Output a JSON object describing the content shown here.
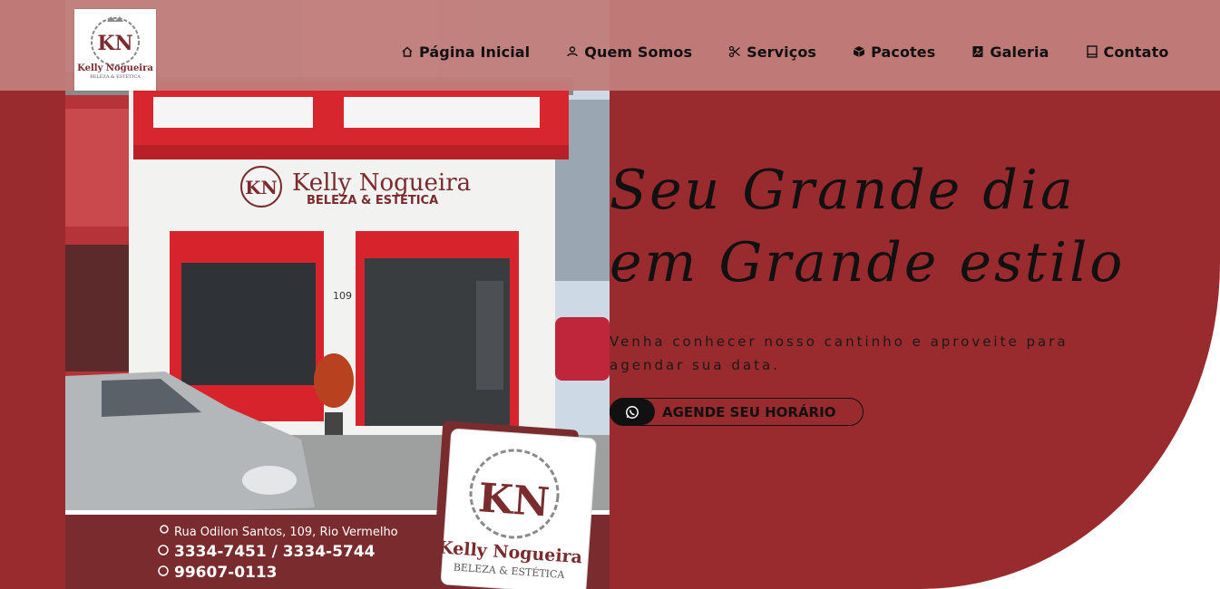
{
  "brand": {
    "name": "Kelly Nogueira",
    "tagline": "BELEZA & ESTÉTICA",
    "monogram": "KN"
  },
  "nav": {
    "items": [
      {
        "label": "Página Inicial",
        "icon": "home-icon"
      },
      {
        "label": "Quem Somos",
        "icon": "people-icon"
      },
      {
        "label": "Serviços",
        "icon": "scissors-icon"
      },
      {
        "label": "Pacotes",
        "icon": "box-icon"
      },
      {
        "label": "Galeria",
        "icon": "gallery-icon"
      },
      {
        "label": "Contato",
        "icon": "book-icon"
      }
    ]
  },
  "hero": {
    "title_line1": "Seu Grande dia",
    "title_line2": "em Grande estilo",
    "subtitle": "Venha conhecer nosso cantinho e aproveite para agendar sua data.",
    "cta_label": "AGENDE SEU HORÁRIO",
    "cta_icon": "whatsapp-icon"
  },
  "photo": {
    "store_sign_name": "Kelly Nogueira",
    "store_sign_tagline": "BELEZA & ESTÉTICA",
    "address": "Rua Odilon Santos, 109, Rio Vermelho",
    "phone": "3334-7451 / 3334-5744",
    "whatsapp": "99607-0113",
    "street_number": "109"
  },
  "colors": {
    "brand_red": "#992a2d",
    "header_pink": "#c17d7b",
    "text_dark": "#111111"
  }
}
